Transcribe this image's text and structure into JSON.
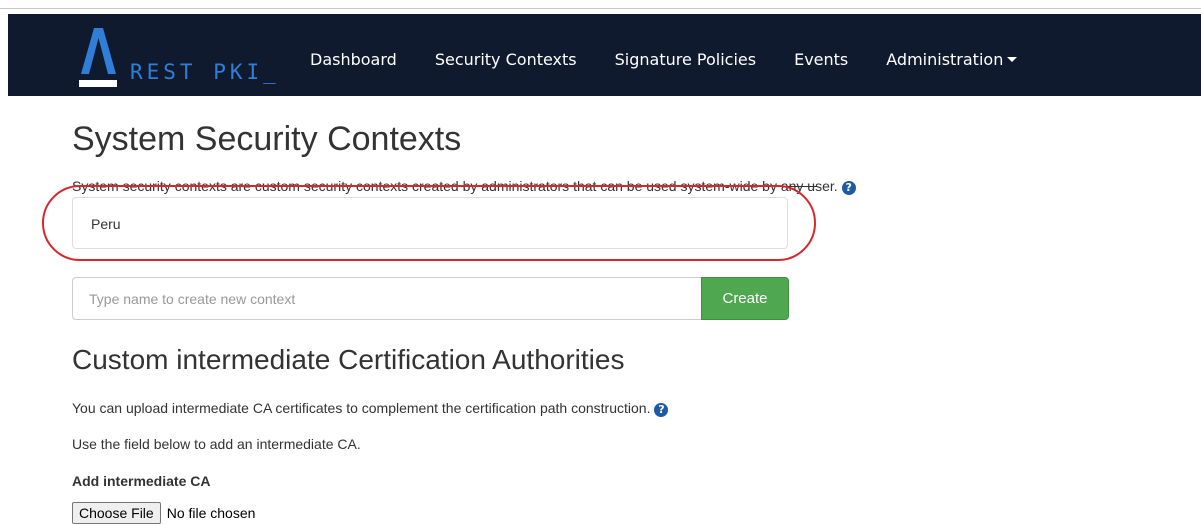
{
  "navbar": {
    "brand_text": "REST PKI_",
    "items": [
      {
        "label": "Dashboard"
      },
      {
        "label": "Security Contexts"
      },
      {
        "label": "Signature Policies"
      },
      {
        "label": "Events"
      },
      {
        "label": "Administration"
      }
    ],
    "background": "#0f1a2e",
    "accent": "#2f7fd8"
  },
  "page": {
    "title": "System Security Contexts",
    "description": "System security contexts are custom security contexts created by administrators that can be used system-wide by any user.",
    "help_icon": "question-circle-icon"
  },
  "contexts": [
    {
      "name": "Peru"
    }
  ],
  "new_context": {
    "placeholder": "Type name to create new context",
    "value": "",
    "create_label": "Create",
    "create_color": "#4fa84f"
  },
  "intermediate": {
    "title": "Custom intermediate Certification Authorities",
    "paragraph1": "You can upload intermediate CA certificates to complement the certification path construction.",
    "paragraph2": "Use the field below to add an intermediate CA.",
    "field_label": "Add intermediate CA",
    "choose_file_label": "Choose File",
    "no_file_text": "No file chosen"
  },
  "annotation": {
    "highlight_color": "#d9262b"
  }
}
